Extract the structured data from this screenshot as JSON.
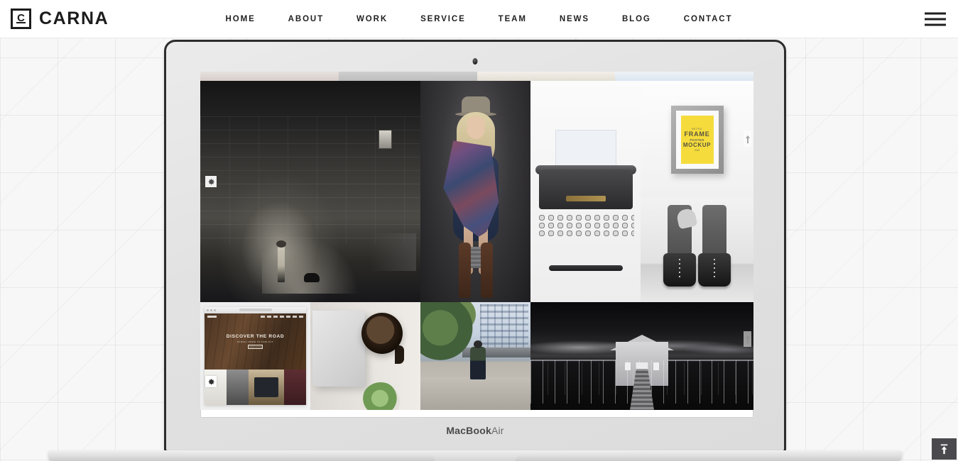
{
  "header": {
    "brand": {
      "mark_glyph": "C",
      "name": "CARNA"
    },
    "nav": [
      {
        "label": "HOME"
      },
      {
        "label": "ABOUT"
      },
      {
        "label": "WORK"
      },
      {
        "label": "SERVICE"
      },
      {
        "label": "TEAM"
      },
      {
        "label": "NEWS"
      },
      {
        "label": "BLOG"
      },
      {
        "label": "CONTACT"
      }
    ],
    "menu_icon": "hamburger-icon"
  },
  "device": {
    "type": "laptop-mockup",
    "label_bold": "MacBook",
    "label_light": "Air",
    "camera": "webcam-dot"
  },
  "gallery": {
    "row1": [
      {
        "name": "street-wall-photo",
        "caption": "Girl walking dog by stone wall"
      },
      {
        "name": "fashion-model-photo",
        "caption": "Blonde model in hat and boots"
      },
      {
        "name": "typewriter-photo",
        "caption": "Vintage typewriter with paper"
      },
      {
        "name": "frame-mockup-photo",
        "caption": "Yellow framed poster mockup"
      },
      {
        "name": "boots-photo",
        "caption": "Black lace-up boots"
      }
    ],
    "row2": [
      {
        "name": "website-mockup-photo",
        "caption": "Browser website mockup"
      },
      {
        "name": "coffee-desk-photo",
        "caption": "Coffee cup and laptop on desk"
      },
      {
        "name": "city-sitting-photo",
        "caption": "Person sitting by bridge"
      },
      {
        "name": "jetty-boathouse-photo",
        "caption": "Boat house at end of jetty"
      }
    ],
    "poster": {
      "line1": "RETRO",
      "line2": "FRAME",
      "line3": "POSTER",
      "line4": "MOCKUP",
      "line5": "2015"
    },
    "mockup": {
      "headline": "DISCOVER THE ROAD",
      "subline": "SCROLL DOWN TO FIND OUT"
    },
    "controls": {
      "gear_icon": "gear-icon",
      "arrow_icon": "arrow-up-icon"
    }
  },
  "scroll_top": {
    "icon": "arrow-up-icon",
    "label": ""
  },
  "colors": {
    "header_bg": "#ffffff",
    "text": "#1f1f1f",
    "page_bg": "#f7f7f7",
    "accent_yellow": "#f5dc3c",
    "scroll_top_bg": "#4a4a4e"
  }
}
